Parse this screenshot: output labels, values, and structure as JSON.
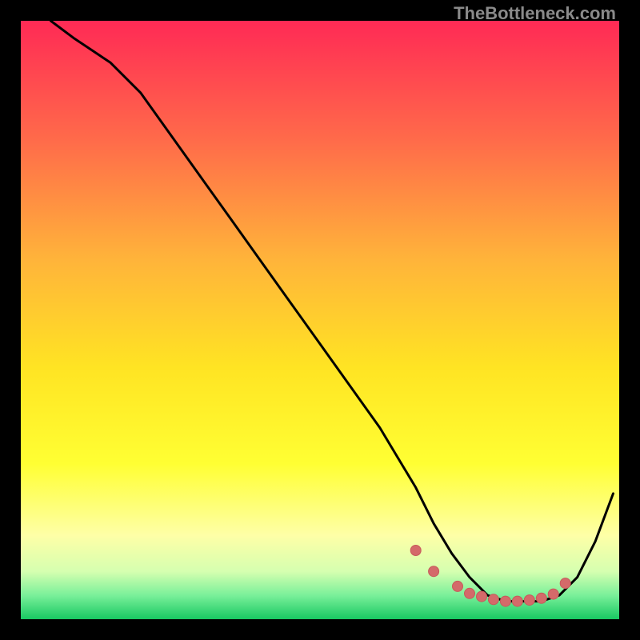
{
  "watermark": {
    "text": "TheBottleneck.com"
  },
  "colors": {
    "black": "#000000",
    "curve": "#000000",
    "marker_fill": "#d46a6a",
    "marker_stroke": "#c75a5a",
    "gradient_top": "#ff2a55",
    "gradient_mid1": "#ff8a3d",
    "gradient_mid2": "#ffd21f",
    "gradient_mid3": "#ffff33",
    "gradient_mid4": "#f6ff9e",
    "gradient_bottom_a": "#b7ff8a",
    "gradient_bottom_b": "#28e06f",
    "gradient_bottom_c": "#0fc45b"
  },
  "chart_data": {
    "type": "line",
    "title": "",
    "xlabel": "",
    "ylabel": "",
    "xlim": [
      0,
      100
    ],
    "ylim": [
      0,
      100
    ],
    "series": [
      {
        "name": "bottleneck-curve",
        "x": [
          5,
          9,
          12,
          15,
          20,
          25,
          30,
          35,
          40,
          45,
          50,
          55,
          60,
          63,
          66,
          69,
          72,
          75,
          78,
          81,
          84,
          87,
          90,
          93,
          96,
          99
        ],
        "values": [
          100,
          97,
          95,
          93,
          88,
          81,
          74,
          67,
          60,
          53,
          46,
          39,
          32,
          27,
          22,
          16,
          11,
          7,
          4,
          3,
          3,
          3,
          4,
          7,
          13,
          21
        ]
      }
    ],
    "markers": {
      "name": "optimal-range-markers",
      "x": [
        66,
        69,
        73,
        75,
        77,
        79,
        81,
        83,
        85,
        87,
        89,
        91
      ],
      "values": [
        11.5,
        8.0,
        5.5,
        4.3,
        3.8,
        3.3,
        3.0,
        3.0,
        3.2,
        3.5,
        4.2,
        6.0
      ]
    }
  }
}
